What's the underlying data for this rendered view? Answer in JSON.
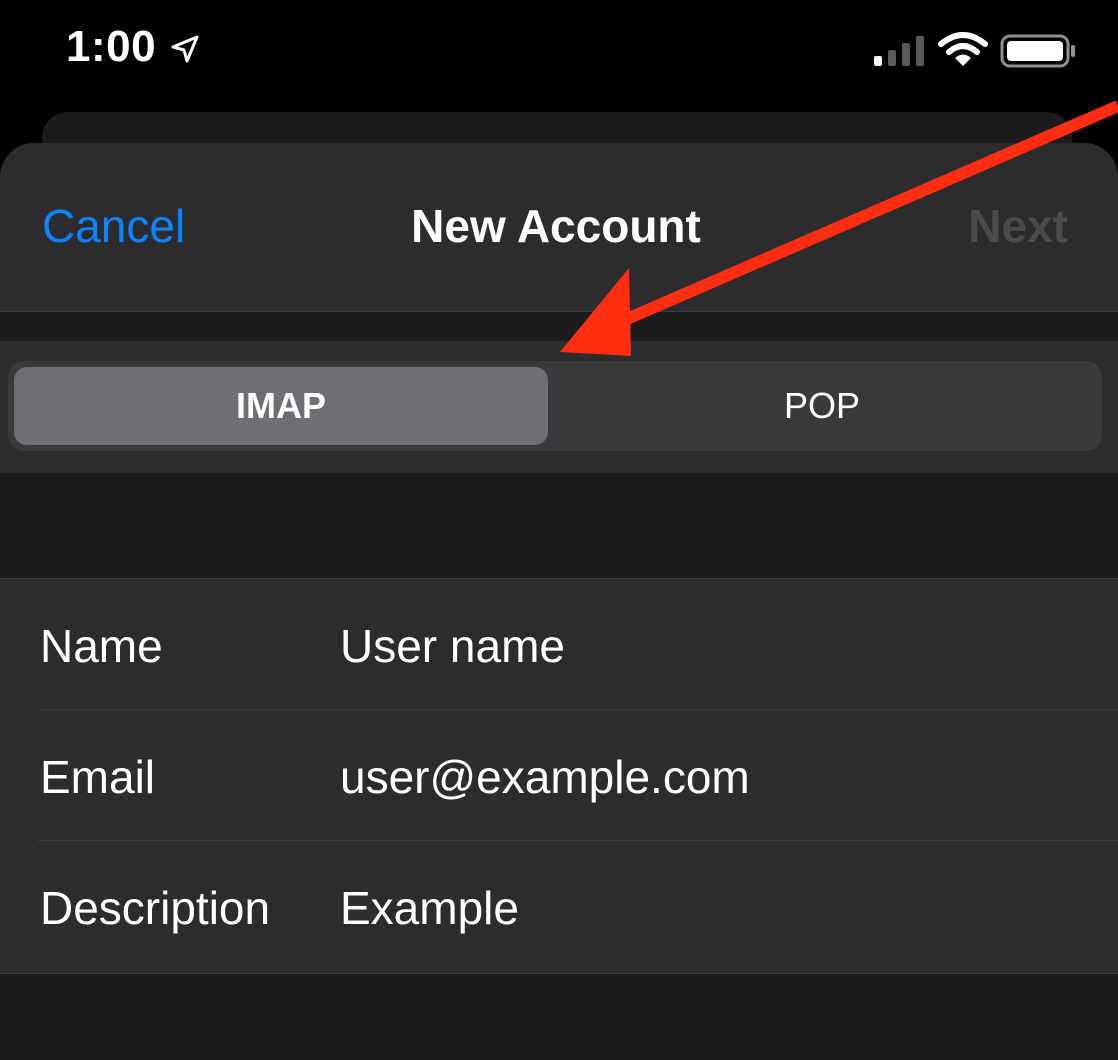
{
  "status_bar": {
    "time": "1:00",
    "icons": [
      "location-arrow-icon",
      "cellular-signal-icon",
      "wifi-icon",
      "battery-icon"
    ]
  },
  "nav": {
    "cancel_label": "Cancel",
    "title": "New Account",
    "next_label": "Next"
  },
  "segmented_control": {
    "options": [
      "IMAP",
      "POP"
    ],
    "selected": "IMAP"
  },
  "form": {
    "rows": [
      {
        "label": "Name",
        "value": "User name"
      },
      {
        "label": "Email",
        "value": "user@example.com"
      },
      {
        "label": "Description",
        "value": "Example"
      }
    ]
  },
  "colors": {
    "background": "#000000",
    "sheet": "#1c1c1e",
    "grouped_cell": "#2c2c2e",
    "accent_blue": "#0a84ff",
    "disabled_text": "#4b4b4e",
    "segment_selected": "#6e6e73",
    "annotation_arrow": "#ff2d12"
  }
}
